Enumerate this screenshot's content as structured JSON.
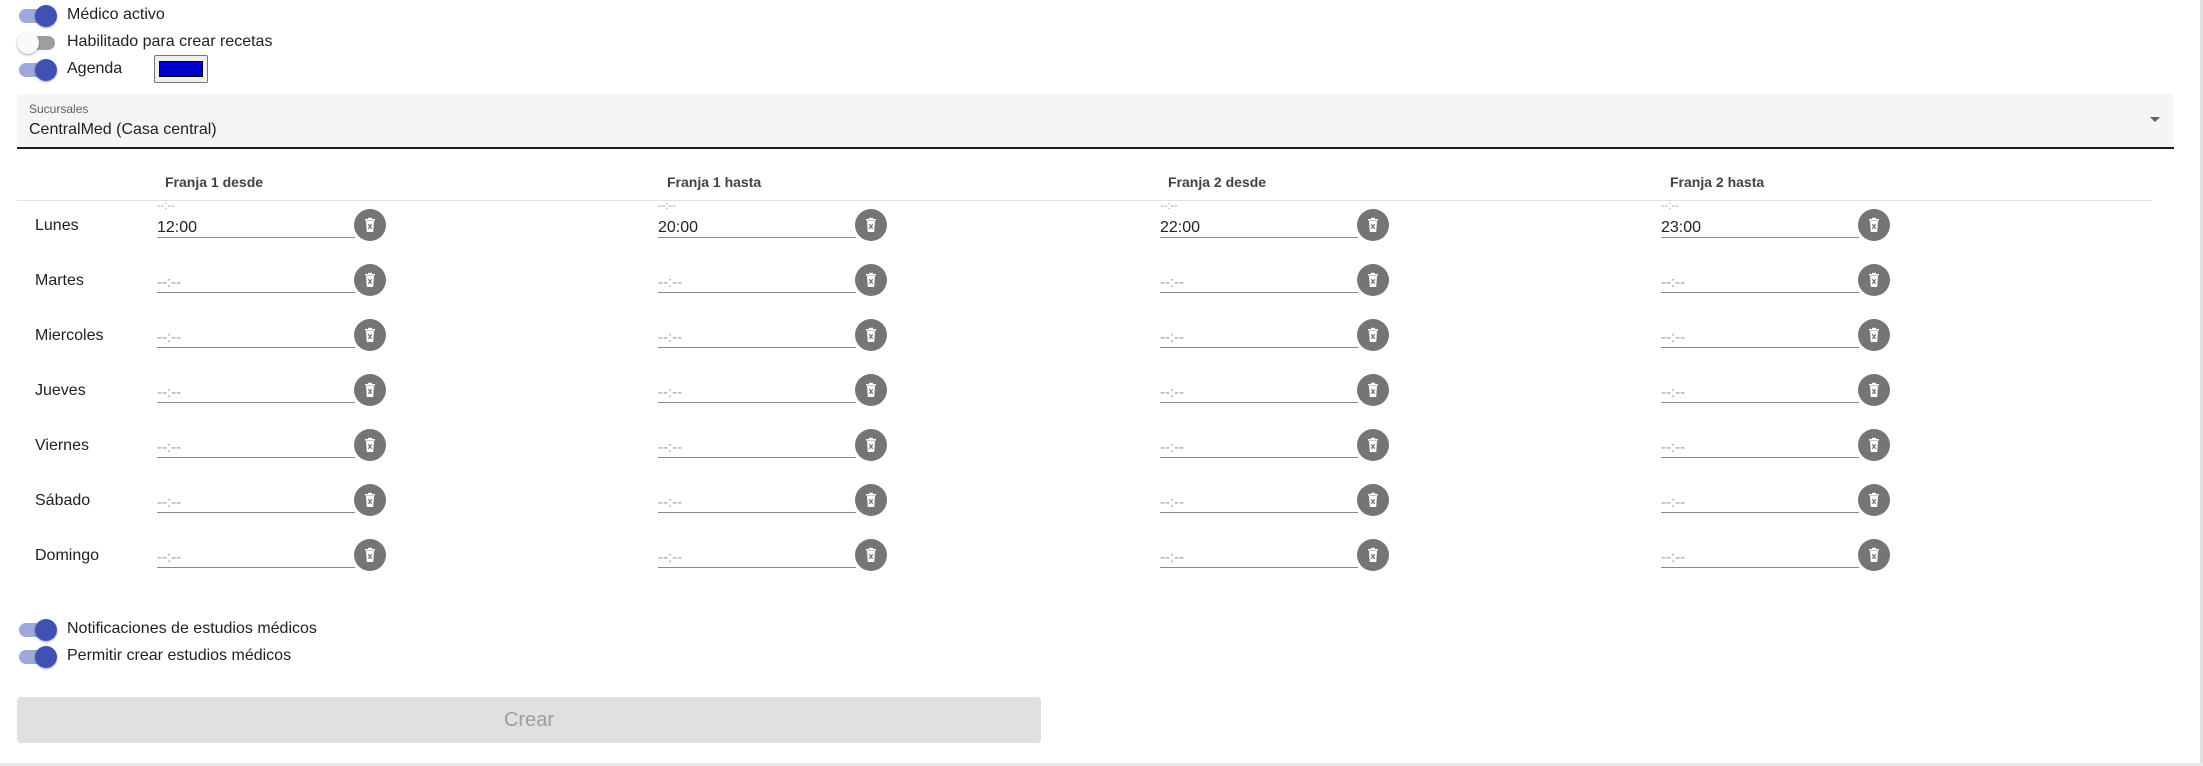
{
  "switches": {
    "medico_activo": {
      "label": "Médico activo",
      "on": true
    },
    "habilitado_recetas": {
      "label": "Habilitado para crear recetas",
      "on": false
    },
    "agenda": {
      "label": "Agenda",
      "on": true,
      "color": "#0000cc"
    },
    "notificaciones": {
      "label": "Notificaciones de estudios médicos",
      "on": true
    },
    "permitir_estudios": {
      "label": "Permitir crear estudios médicos",
      "on": true
    }
  },
  "sucursales": {
    "label": "Sucursales",
    "value": "CentralMed (Casa central)"
  },
  "schedule": {
    "columns": [
      "Franja 1 desde",
      "Franja 1 hasta",
      "Franja 2 desde",
      "Franja 2 hasta"
    ],
    "time_placeholder": "--:--",
    "days": [
      {
        "name": "Lunes",
        "values": [
          "12:00",
          "20:00",
          "22:00",
          "23:00"
        ]
      },
      {
        "name": "Martes",
        "values": [
          "",
          "",
          "",
          ""
        ]
      },
      {
        "name": "Miercoles",
        "values": [
          "",
          "",
          "",
          ""
        ]
      },
      {
        "name": "Jueves",
        "values": [
          "",
          "",
          "",
          ""
        ]
      },
      {
        "name": "Viernes",
        "values": [
          "",
          "",
          "",
          ""
        ]
      },
      {
        "name": "Sábado",
        "values": [
          "",
          "",
          "",
          ""
        ]
      },
      {
        "name": "Domingo",
        "values": [
          "",
          "",
          "",
          ""
        ]
      }
    ]
  },
  "actions": {
    "create_label": "Crear"
  },
  "colors": {
    "accent": "#3f51b5",
    "accent_track": "#9fa8da",
    "clear_button": "#757575",
    "disabled_button": "#e0e0e0"
  },
  "icons": {
    "clear": "trash-clear-icon",
    "dropdown": "chevron-down-icon"
  }
}
